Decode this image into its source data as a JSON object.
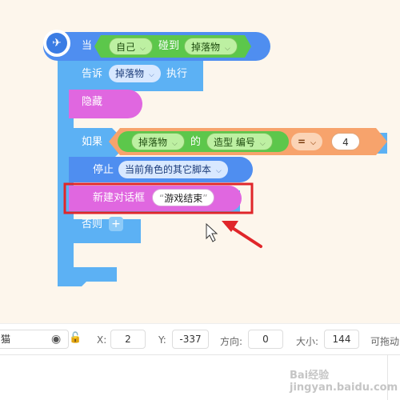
{
  "script": {
    "hat": {
      "label": "当",
      "sprite": "自己",
      "verb": "碰到",
      "target": "掉落物"
    },
    "broadcast": {
      "label": "告诉",
      "target": "掉落物",
      "action": "执行"
    },
    "hide": {
      "label": "隐藏"
    },
    "if_block": {
      "label": "如果",
      "operand_sprite": "掉落物",
      "of": "的",
      "property": "造型 编号",
      "operator": "=",
      "value": "4"
    },
    "stop": {
      "label": "停止",
      "option": "当前角色的其它脚本"
    },
    "dialog": {
      "label": "新建对话框",
      "text": "游戏结束"
    },
    "else_label": "否则",
    "else_add": "+"
  },
  "sprite_bar": {
    "name_fragment": "猫",
    "x_label": "X:",
    "x_value": "2",
    "y_label": "Y:",
    "y_value": "-337",
    "direction_label": "方向:",
    "direction_value": "0",
    "size_label": "大小:",
    "size_value": "144",
    "draggable_label": "可拖动"
  },
  "watermark": "Bai经验 jingyan.baidu.com",
  "colors": {
    "control_blue": "#5cb1f4",
    "event_blue": "#4f8ef0",
    "looks_pink": "#e067e0",
    "operator_orange": "#f7a36c",
    "green": "#5cc74b",
    "highlight_red": "#e0262a"
  }
}
